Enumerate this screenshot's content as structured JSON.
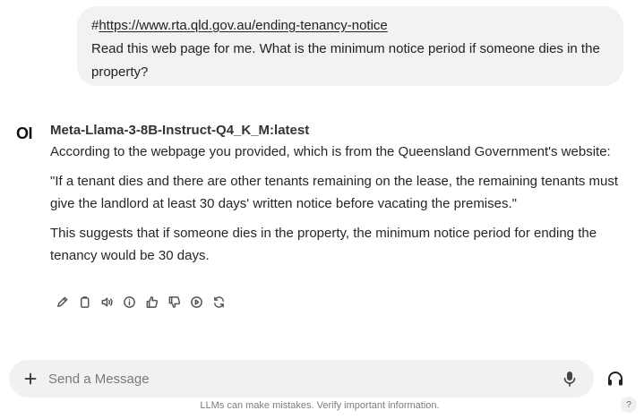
{
  "user_message": {
    "hash": "#",
    "link": "https://www.rta.qld.gov.au/ending-tenancy-notice",
    "text": "Read this web page for me. What is the minimum notice period if someone dies in the property?"
  },
  "assistant": {
    "avatar": "OI",
    "model_name": "Meta-Llama-3-8B-Instruct-Q4_K_M:latest",
    "paragraphs": [
      "According to the webpage you provided, which is from the Queensland Government's website:",
      "\"If a tenant dies and there are other tenants remaining on the lease, the remaining tenants must give the landlord at least 30 days' written notice before vacating the premises.\"",
      "This suggests that if someone dies in the property, the minimum notice period for ending the tenancy would be 30 days."
    ],
    "actions": [
      "edit-icon",
      "copy-icon",
      "speaker-icon",
      "info-icon",
      "thumbs-up-icon",
      "thumbs-down-icon",
      "play-icon",
      "regenerate-icon"
    ]
  },
  "composer": {
    "placeholder": "Send a Message",
    "disclaimer": "LLMs can make mistakes. Verify important information.",
    "help": "?"
  }
}
